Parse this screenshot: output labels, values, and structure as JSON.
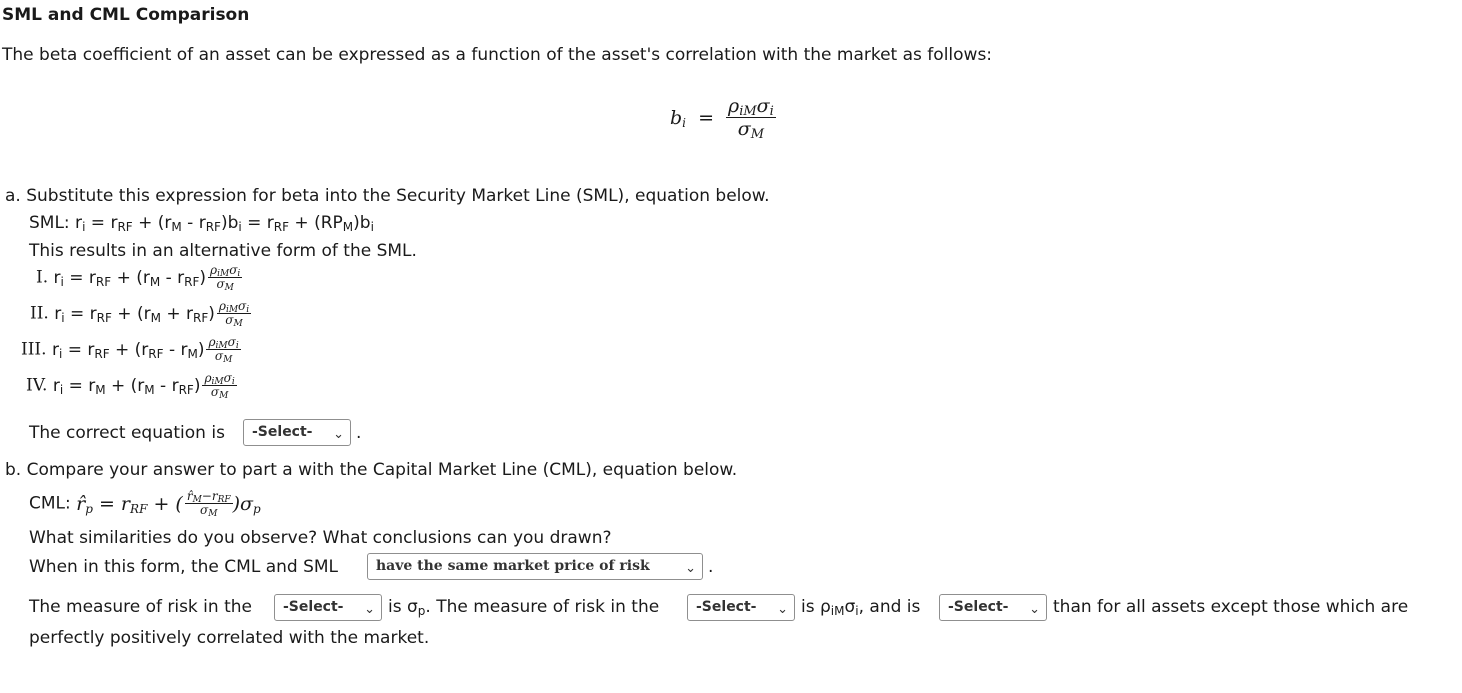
{
  "title": "SML and CML Comparison",
  "intro": "The beta coefficient of an asset can be expressed as a function of the asset's correlation with the market as follows:",
  "part_a": {
    "heading": "a. Substitute this expression for beta into the Security Market Line (SML), equation below.",
    "results": "This results in an alternative form of the SML.",
    "options": [
      "I.",
      "II.",
      "III.",
      "IV."
    ],
    "correct_prefix": "The correct equation is",
    "select_value": "-Select-"
  },
  "part_b": {
    "heading": "b. Compare your answer to part a with the Capital Market Line (CML), equation below.",
    "cml_label": "CML:",
    "question": "What similarities do you observe? What conclusions can you drawn?",
    "form_prefix": "When in this form, the CML and SML",
    "form_select": "have the same market price of risk",
    "measure1_prefix": "The measure of risk in the",
    "select1": "-Select-",
    "measure1_mid": "is σ",
    "measure2_prefix": ". The measure of risk in the",
    "select2": "-Select-",
    "measure2_mid": "is ρ",
    "measure2_and": ", and is",
    "select3": "-Select-",
    "measure_tail": "than for all assets except those which are",
    "last_line": "perfectly positively correlated with the market."
  },
  "icons": {
    "dropdown": "chevron-down-icon"
  }
}
